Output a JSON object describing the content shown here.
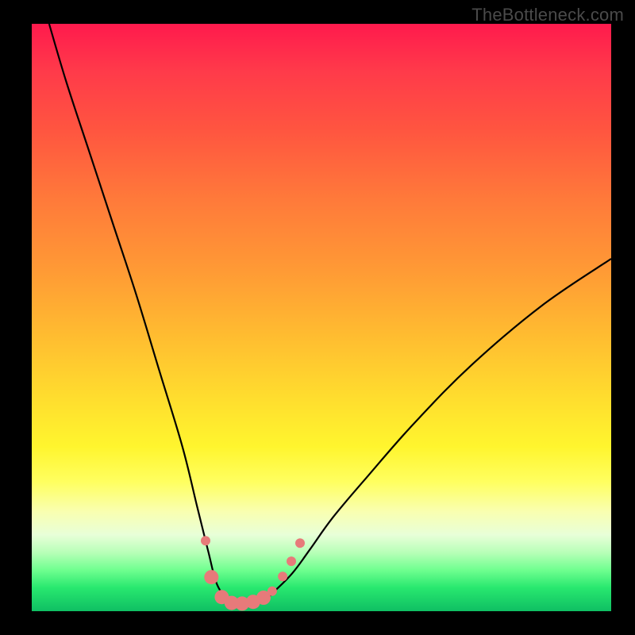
{
  "watermark": "TheBottleneck.com",
  "chart_data": {
    "type": "line",
    "title": "",
    "xlabel": "",
    "ylabel": "",
    "xlim": [
      0,
      100
    ],
    "ylim": [
      0,
      100
    ],
    "curve": {
      "name": "bottleneck-curve",
      "x": [
        3,
        6,
        10,
        14,
        18,
        22,
        26,
        28.5,
        30.5,
        32,
        34,
        36,
        38,
        40,
        42,
        45,
        48,
        52,
        58,
        66,
        76,
        88,
        100
      ],
      "y": [
        100,
        90,
        78,
        66,
        54,
        41,
        28,
        18,
        10,
        4.5,
        2,
        1,
        1,
        1.7,
        3.5,
        6.5,
        10.5,
        16,
        23,
        32,
        42,
        52,
        60
      ]
    },
    "markers": {
      "name": "highlight-dots",
      "color": "#e77a7a",
      "radius_small": 6,
      "radius_large": 9,
      "points": [
        {
          "x": 30.0,
          "y": 12.0,
          "r": "small"
        },
        {
          "x": 31.0,
          "y": 5.8,
          "r": "large"
        },
        {
          "x": 32.8,
          "y": 2.4,
          "r": "large"
        },
        {
          "x": 34.5,
          "y": 1.4,
          "r": "large"
        },
        {
          "x": 36.3,
          "y": 1.3,
          "r": "large"
        },
        {
          "x": 38.2,
          "y": 1.6,
          "r": "large"
        },
        {
          "x": 40.0,
          "y": 2.3,
          "r": "large"
        },
        {
          "x": 41.5,
          "y": 3.4,
          "r": "small"
        },
        {
          "x": 43.3,
          "y": 5.9,
          "r": "small"
        },
        {
          "x": 44.8,
          "y": 8.5,
          "r": "small"
        },
        {
          "x": 46.3,
          "y": 11.6,
          "r": "small"
        }
      ]
    },
    "gradient_stops": [
      {
        "pos": 0,
        "color": "#ff1a4d"
      },
      {
        "pos": 18,
        "color": "#ff5540"
      },
      {
        "pos": 42,
        "color": "#ff9a35"
      },
      {
        "pos": 65,
        "color": "#ffe12e"
      },
      {
        "pos": 83,
        "color": "#f9ffb0"
      },
      {
        "pos": 93,
        "color": "#6fff8f"
      },
      {
        "pos": 100,
        "color": "#0fbf63"
      }
    ]
  }
}
